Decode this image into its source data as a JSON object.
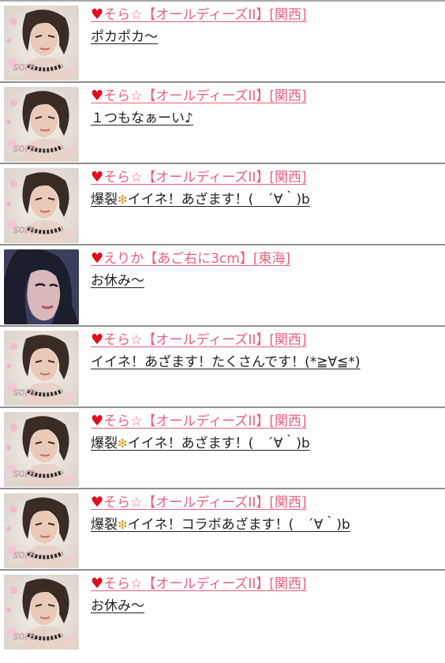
{
  "colors": {
    "name": "#e9617d",
    "heart": "#e30d20",
    "message": "#222222",
    "divider": "#8f8f8f"
  },
  "comments": [
    {
      "avatar": "avatar-sora",
      "heart": "♥",
      "name": "そら☆【オールディーズII】[関西]",
      "message": "ポカポカ〜",
      "sparkle": false
    },
    {
      "avatar": "avatar-sora",
      "heart": "♥",
      "name": "そら☆【オールディーズII】[関西]",
      "message": "１つもなぁーい♪",
      "sparkle": false
    },
    {
      "avatar": "avatar-sora",
      "heart": "♥",
      "name": "そら☆【オールディーズII】[関西]",
      "message_pre": "爆裂",
      "message": "イイネ！あざます！(　´∀｀)b",
      "sparkle": true
    },
    {
      "avatar": "avatar-erika",
      "heart": "♥",
      "name": "えりか【あご右に3cm】[東海]",
      "message": "お休み〜",
      "sparkle": false
    },
    {
      "avatar": "avatar-sora",
      "heart": "♥",
      "name": "そら☆【オールディーズII】[関西]",
      "message": "イイネ！あざます！たくさんです！(*≧∀≦*)",
      "sparkle": false
    },
    {
      "avatar": "avatar-sora",
      "heart": "♥",
      "name": "そら☆【オールディーズII】[関西]",
      "message_pre": "爆裂",
      "message": "イイネ！あざます！(　´∀｀)b",
      "sparkle": true
    },
    {
      "avatar": "avatar-sora",
      "heart": "♥",
      "name": "そら☆【オールディーズII】[関西]",
      "message_pre": "爆裂",
      "message": "イイネ！コラボあざます！(　´∀｀)b",
      "sparkle": true
    },
    {
      "avatar": "avatar-sora",
      "heart": "♥",
      "name": "そら☆【オールディーズII】[関西]",
      "message": "お休み〜",
      "sparkle": false
    }
  ],
  "avatar_caption": "sora",
  "sparkle_icon": "sparkle-icon"
}
